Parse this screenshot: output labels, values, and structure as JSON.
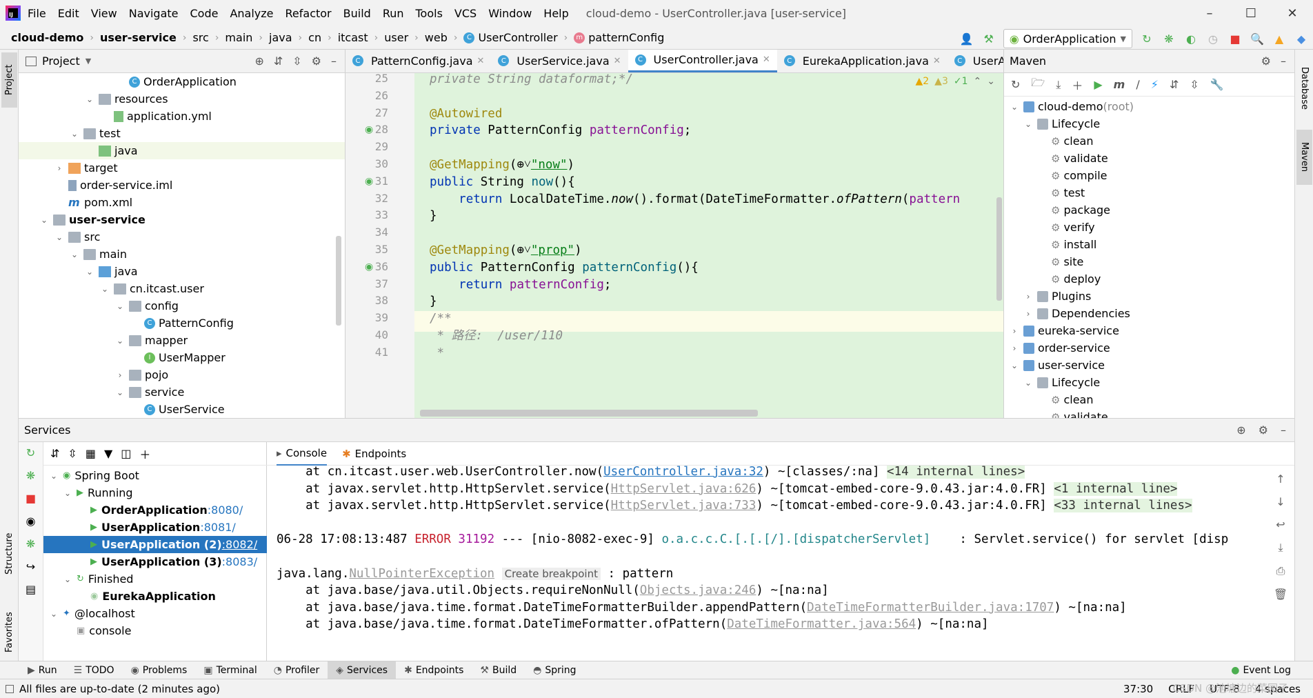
{
  "app": {
    "title": "cloud-demo - UserController.java [user-service]"
  },
  "menu": [
    "File",
    "Edit",
    "View",
    "Navigate",
    "Code",
    "Analyze",
    "Refactor",
    "Build",
    "Run",
    "Tools",
    "VCS",
    "Window",
    "Help"
  ],
  "breadcrumb": [
    "cloud-demo",
    "user-service",
    "src",
    "main",
    "java",
    "cn",
    "itcast",
    "user",
    "web",
    "UserController",
    "patternConfig"
  ],
  "run_config": "OrderApplication",
  "project": {
    "title": "Project",
    "rows": [
      {
        "label": "OrderApplication",
        "indent": 6,
        "type": "class-run",
        "tw": ""
      },
      {
        "label": "resources",
        "indent": 4,
        "type": "folder",
        "tw": "v"
      },
      {
        "label": "application.yml",
        "indent": 5,
        "type": "yml",
        "tw": ""
      },
      {
        "label": "test",
        "indent": 3,
        "type": "folder",
        "tw": "v"
      },
      {
        "label": "java",
        "indent": 4,
        "type": "folder-green",
        "tw": ""
      },
      {
        "label": "target",
        "indent": 2,
        "type": "folder-orange",
        "tw": ">"
      },
      {
        "label": "order-service.iml",
        "indent": 2,
        "type": "file",
        "tw": ""
      },
      {
        "label": "pom.xml",
        "indent": 2,
        "type": "maven",
        "tw": ""
      },
      {
        "label": "user-service",
        "indent": 1,
        "type": "module",
        "tw": "v",
        "bold": true
      },
      {
        "label": "src",
        "indent": 2,
        "type": "folder",
        "tw": "v"
      },
      {
        "label": "main",
        "indent": 3,
        "type": "folder",
        "tw": "v"
      },
      {
        "label": "java",
        "indent": 4,
        "type": "folder-blue",
        "tw": "v"
      },
      {
        "label": "cn.itcast.user",
        "indent": 5,
        "type": "folder",
        "tw": "v"
      },
      {
        "label": "config",
        "indent": 6,
        "type": "folder",
        "tw": "v"
      },
      {
        "label": "PatternConfig",
        "indent": 7,
        "type": "class",
        "tw": ""
      },
      {
        "label": "mapper",
        "indent": 6,
        "type": "folder",
        "tw": "v"
      },
      {
        "label": "UserMapper",
        "indent": 7,
        "type": "interface",
        "tw": ""
      },
      {
        "label": "pojo",
        "indent": 6,
        "type": "folder",
        "tw": ">"
      },
      {
        "label": "service",
        "indent": 6,
        "type": "folder",
        "tw": "v"
      },
      {
        "label": "UserService",
        "indent": 7,
        "type": "class",
        "tw": ""
      }
    ]
  },
  "editor": {
    "tabs": [
      "PatternConfig.java",
      "UserService.java",
      "UserController.java",
      "EurekaApplication.java",
      "UserApplic"
    ],
    "active_tab": 2,
    "inspections": {
      "warnings": "2",
      "weak": "3",
      "ok": "1"
    },
    "lines": [
      {
        "n": "25",
        "html": "<span class='cm'>private String dataformat;*/</span>"
      },
      {
        "n": "26",
        "html": ""
      },
      {
        "n": "27",
        "html": "<span class='an'>@Autowired</span>"
      },
      {
        "n": "28",
        "html": "<span class='kw'>private</span> PatternConfig <span class='fld'>patternConfig</span>;"
      },
      {
        "n": "29",
        "html": ""
      },
      {
        "n": "30",
        "html": "<span class='an'>@GetMapping</span>(⊕˅<span class='str'>\"now\"</span>)"
      },
      {
        "n": "31",
        "html": "<span class='kw'>public</span> String <span class='fn'>now</span>(){"
      },
      {
        "n": "32",
        "html": "    <span class='kw'>return</span> LocalDateTime.<span class='it'>now</span>().format(DateTimeFormatter.<span class='it'>ofPattern</span>(<span class='fld'>pattern</span>"
      },
      {
        "n": "33",
        "html": "}"
      },
      {
        "n": "34",
        "html": ""
      },
      {
        "n": "35",
        "html": "<span class='an'>@GetMapping</span>(⊕˅<span class='str'>\"prop\"</span>)"
      },
      {
        "n": "36",
        "html": "<span class='kw'>public</span> PatternConfig <span class='fn'>patternConfig</span>(){"
      },
      {
        "n": "37",
        "html": "    <span class='kw'>return</span> <span class='fld'>patternConfig</span>;"
      },
      {
        "n": "38",
        "html": "}"
      },
      {
        "n": "39",
        "html": "<span class='cm'>/**</span>"
      },
      {
        "n": "40",
        "html": "<span class='cm'> * 路径:  /user/110</span>"
      },
      {
        "n": "41",
        "html": "<span class='cm'> *</span>"
      }
    ]
  },
  "maven": {
    "title": "Maven",
    "rows": [
      {
        "label": "cloud-demo",
        "suffix": " (root)",
        "indent": 0,
        "tw": "v",
        "type": "mod"
      },
      {
        "label": "Lifecycle",
        "indent": 1,
        "tw": "v",
        "type": "lc"
      },
      {
        "label": "clean",
        "indent": 2,
        "tw": "",
        "type": "goal"
      },
      {
        "label": "validate",
        "indent": 2,
        "tw": "",
        "type": "goal"
      },
      {
        "label": "compile",
        "indent": 2,
        "tw": "",
        "type": "goal"
      },
      {
        "label": "test",
        "indent": 2,
        "tw": "",
        "type": "goal"
      },
      {
        "label": "package",
        "indent": 2,
        "tw": "",
        "type": "goal"
      },
      {
        "label": "verify",
        "indent": 2,
        "tw": "",
        "type": "goal"
      },
      {
        "label": "install",
        "indent": 2,
        "tw": "",
        "type": "goal"
      },
      {
        "label": "site",
        "indent": 2,
        "tw": "",
        "type": "goal"
      },
      {
        "label": "deploy",
        "indent": 2,
        "tw": "",
        "type": "goal"
      },
      {
        "label": "Plugins",
        "indent": 1,
        "tw": ">",
        "type": "lc"
      },
      {
        "label": "Dependencies",
        "indent": 1,
        "tw": ">",
        "type": "lc"
      },
      {
        "label": "eureka-service",
        "indent": 0,
        "tw": ">",
        "type": "mod"
      },
      {
        "label": "order-service",
        "indent": 0,
        "tw": ">",
        "type": "mod"
      },
      {
        "label": "user-service",
        "indent": 0,
        "tw": "v",
        "type": "mod"
      },
      {
        "label": "Lifecycle",
        "indent": 1,
        "tw": "v",
        "type": "lc"
      },
      {
        "label": "clean",
        "indent": 2,
        "tw": "",
        "type": "goal"
      },
      {
        "label": "validate",
        "indent": 2,
        "tw": "",
        "type": "goal"
      }
    ]
  },
  "services": {
    "title": "Services",
    "rows": [
      {
        "label": "Spring Boot",
        "indent": 0,
        "tw": "v",
        "type": "spring"
      },
      {
        "label": "Running",
        "indent": 1,
        "tw": "v",
        "type": "run"
      },
      {
        "label": "OrderApplication",
        "port": ":8080/",
        "indent": 2,
        "type": "app"
      },
      {
        "label": "UserApplication",
        "port": ":8081/",
        "indent": 2,
        "type": "app"
      },
      {
        "label": "UserApplication (2)",
        "port": ":8082/",
        "indent": 2,
        "type": "app",
        "selected": true
      },
      {
        "label": "UserApplication (3)",
        "port": ":8083/",
        "indent": 2,
        "type": "app"
      },
      {
        "label": "Finished",
        "indent": 1,
        "tw": "v",
        "type": "fin"
      },
      {
        "label": "EurekaApplication",
        "port": "",
        "indent": 2,
        "type": "app-fin"
      },
      {
        "label": "@localhost",
        "indent": 0,
        "tw": "v",
        "type": "db"
      },
      {
        "label": "console",
        "indent": 1,
        "tw": "",
        "type": "console"
      }
    ],
    "console_tabs": [
      "Console",
      "Endpoints"
    ],
    "console_lines": [
      "    at cn.itcast.user.web.UserController.now(<span class='lnk'>UserController.java:32</span>) ~[classes/:na] <span class='fold'>&lt;14 internal lines&gt;</span>",
      "    at javax.servlet.http.HttpServlet.service(<span class='glnk'>HttpServlet.java:626</span>) ~[tomcat-embed-core-9.0.43.jar:4.0.FR] <span class='fold'>&lt;1 internal line&gt;</span>",
      "    at javax.servlet.http.HttpServlet.service(<span class='glnk'>HttpServlet.java:733</span>) ~[tomcat-embed-core-9.0.43.jar:4.0.FR] <span class='fold'>&lt;33 internal lines&gt;</span>",
      "",
      "06-28 17:08:13:487 <span class='err'>ERROR</span> <span class='pid'>31192</span> --- [nio-8082-exec-9] <span class='logger'>o.a.c.c.C.[.[.[/].[dispatcherServlet]</span>    : Servlet.service() for servlet [disp",
      "",
      "java.lang.<span class='glnk'>NullPointerException</span> <span class='bp'>Create breakpoint</span> : pattern",
      "    at java.base/java.util.Objects.requireNonNull(<span class='glnk'>Objects.java:246</span>) ~[na:na]",
      "    at java.base/java.time.format.DateTimeFormatterBuilder.appendPattern(<span class='glnk'>DateTimeFormatterBuilder.java:1707</span>) ~[na:na]",
      "    at java.base/java.time.format.DateTimeFormatter.ofPattern(<span class='glnk'>DateTimeFormatter.java:564</span>) ~[na:na]"
    ]
  },
  "bottom_tools": [
    "Run",
    "TODO",
    "Problems",
    "Terminal",
    "Profiler",
    "Services",
    "Endpoints",
    "Build",
    "Spring"
  ],
  "bottom_active": "Services",
  "event_log": "Event Log",
  "status": {
    "message": "All files are up-to-date (2 minutes ago)",
    "position": "37:30",
    "line_sep": "CRLF",
    "encoding": "UTF-8",
    "indent": "4 spaces"
  },
  "side_tabs": {
    "left_top": "Project",
    "left_structure": "Structure",
    "left_favorites": "Favorites",
    "right_db": "Database",
    "right_maven": "Maven"
  },
  "watermark": "CSDN @池塘边的菜园子"
}
